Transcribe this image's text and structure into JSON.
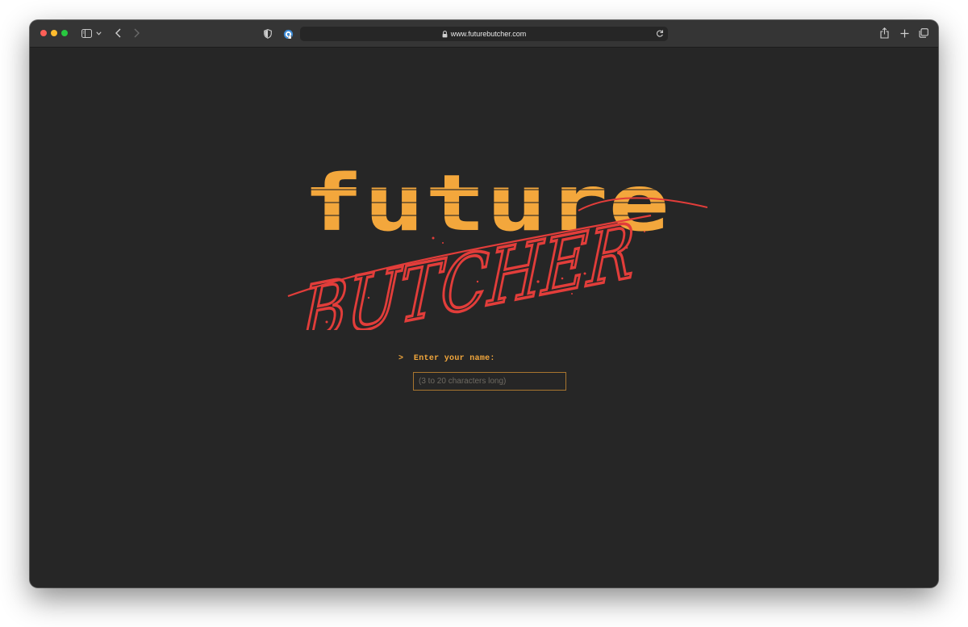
{
  "browser": {
    "url": "www.futurebutcher.com",
    "traffic_lights": {
      "close": "#fe5f57",
      "minimize": "#febc2e",
      "zoom": "#28c840"
    }
  },
  "logo": {
    "line1": "future",
    "line2": "BUTCHER",
    "colors": {
      "pixel_text": "#f3a73c",
      "script_text": "#e23d3a"
    }
  },
  "form": {
    "prompt_marker": ">",
    "prompt_label": "Enter your name:",
    "name_value": "",
    "name_placeholder": "(3 to 20 characters long)"
  },
  "colors": {
    "background": "#262626",
    "accent": "#f3a73c",
    "input_border": "#a8752f"
  }
}
